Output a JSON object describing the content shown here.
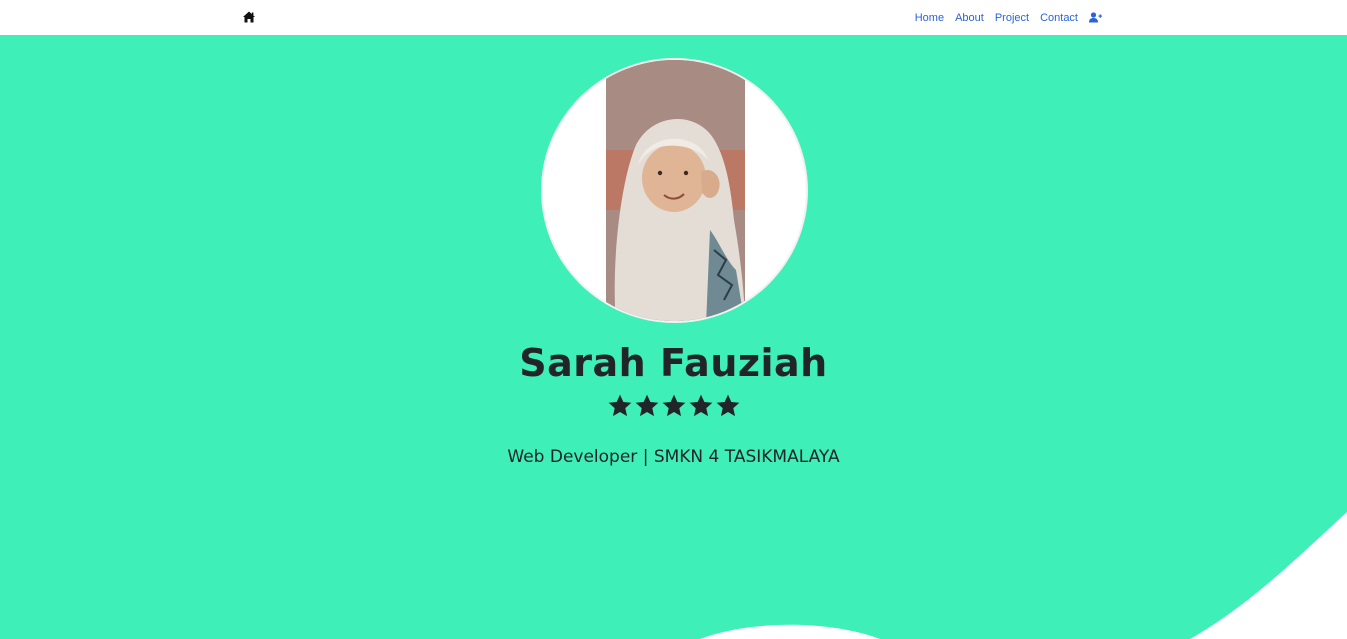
{
  "nav": {
    "brand_icon": "home-icon",
    "links": [
      "Home",
      "About",
      "Project",
      "Contact"
    ],
    "user_icon": "user-plus-icon",
    "link_color": "#2b63d8"
  },
  "hero": {
    "background_color": "#3eefb7",
    "avatar_alt": "profile photo",
    "name": "Sarah Fauziah",
    "rating": 5,
    "star_icon": "star-icon",
    "subtitle": "Web Developer | SMKN 4 TASIKMALAYA"
  }
}
